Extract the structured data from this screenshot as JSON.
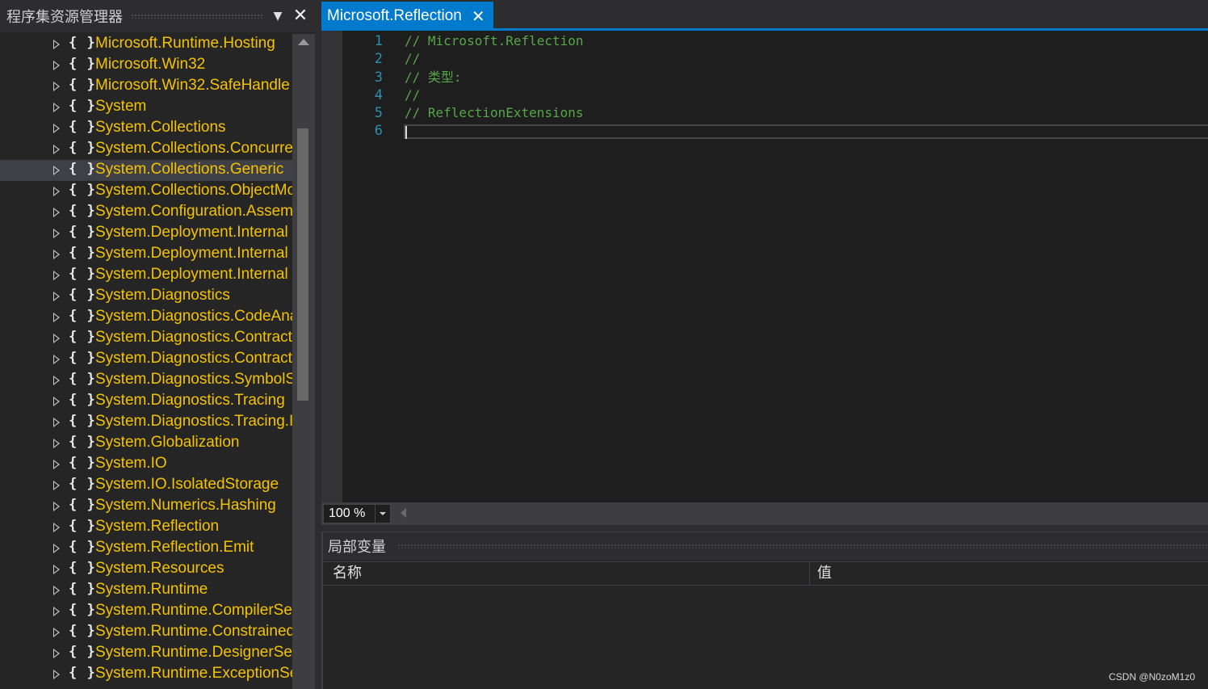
{
  "left_panel": {
    "title": "程序集资源管理器",
    "namespace_icon": "{ }",
    "selected_index": 6,
    "items": [
      "Microsoft.Runtime.Hosting",
      "Microsoft.Win32",
      "Microsoft.Win32.SafeHandle",
      "System",
      "System.Collections",
      "System.Collections.Concurre",
      "System.Collections.Generic",
      "System.Collections.ObjectMo",
      "System.Configuration.Assem",
      "System.Deployment.Internal",
      "System.Deployment.Internal",
      "System.Deployment.Internal",
      "System.Diagnostics",
      "System.Diagnostics.CodeAna",
      "System.Diagnostics.Contract",
      "System.Diagnostics.Contract",
      "System.Diagnostics.SymbolS",
      "System.Diagnostics.Tracing",
      "System.Diagnostics.Tracing.I",
      "System.Globalization",
      "System.IO",
      "System.IO.IsolatedStorage",
      "System.Numerics.Hashing",
      "System.Reflection",
      "System.Reflection.Emit",
      "System.Resources",
      "System.Runtime",
      "System.Runtime.CompilerSe",
      "System.Runtime.Constrained",
      "System.Runtime.DesignerSer",
      "System.Runtime.ExceptionSe"
    ]
  },
  "editor": {
    "tab_label": "Microsoft.Reflection",
    "line_numbers": [
      "1",
      "2",
      "3",
      "4",
      "5",
      "6"
    ],
    "lines": [
      "// Microsoft.Reflection",
      "//",
      "// 类型:",
      "//",
      "// ReflectionExtensions",
      ""
    ]
  },
  "zoom": {
    "value": "100 %"
  },
  "locals": {
    "title": "局部变量",
    "columns": {
      "name": "名称",
      "value": "值"
    }
  },
  "watermark": "CSDN @N0zoM1z0",
  "colors": {
    "accent": "#007acc",
    "namespace_text": "#f4c300",
    "comment": "#57a64a",
    "line_number": "#2b91af"
  }
}
